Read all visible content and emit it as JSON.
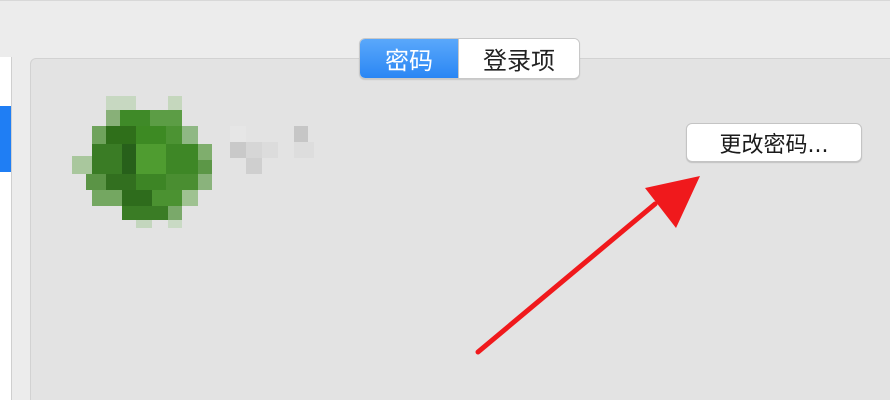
{
  "tabs": [
    {
      "label": "密码",
      "active": true
    },
    {
      "label": "登录项",
      "active": false
    }
  ],
  "change_password_button": "更改密码...",
  "colors": {
    "accent": "#2a86f4",
    "annotation_arrow": "#f0191c",
    "avatar_green": "#3d8a23"
  },
  "icons": {
    "avatar": "user-avatar-pixelated",
    "username": "username-pixelated",
    "annotation": "red-arrow"
  }
}
